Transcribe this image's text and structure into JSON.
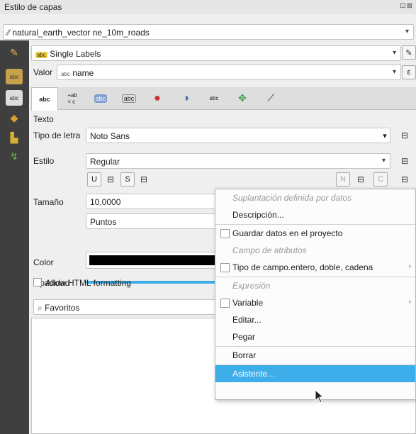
{
  "panel": {
    "title": "Estilo de capas",
    "buttons": "⊡⊠"
  },
  "layer": {
    "name": "natural_earth_vector ne_10m_roads"
  },
  "renderer": {
    "mode": "Single Labels",
    "mode_badge": "abc"
  },
  "value_row": {
    "label": "Valor",
    "field_prefix": "abc",
    "field": "name",
    "expr_symbol": "ε"
  },
  "tabs": [
    {
      "name": "text",
      "glyph": "abc"
    },
    {
      "name": "formatting",
      "glyph": "+ab\n< c"
    },
    {
      "name": "buffer",
      "glyph": "abc"
    },
    {
      "name": "background",
      "glyph": "abc"
    },
    {
      "name": "shadow",
      "glyph": "●"
    },
    {
      "name": "callout",
      "glyph": "◑"
    },
    {
      "name": "placement",
      "glyph": "abc"
    },
    {
      "name": "rendering",
      "glyph": "✥"
    },
    {
      "name": "mask",
      "glyph": "⟋"
    }
  ],
  "section": {
    "title": "Texto"
  },
  "font": {
    "label": "Tipo de letra",
    "value": "Noto Sans"
  },
  "style": {
    "label": "Estilo",
    "value": "Regular"
  },
  "format_buttons": {
    "underline": "U",
    "strike": "S",
    "bold": "N",
    "italic": "C"
  },
  "size": {
    "label": "Tamaño",
    "value": "10,0000",
    "unit": "Puntos"
  },
  "color": {
    "label": "Color",
    "value": "#000000"
  },
  "opacity": {
    "label": "Opacidad"
  },
  "html_formatting": {
    "label": "Allow HTML formatting",
    "checked": false
  },
  "favorites": {
    "label": "Favoritos"
  },
  "menu": {
    "items": [
      {
        "key": "header1",
        "text": "Suplantación definida por datos",
        "disabled": true
      },
      {
        "key": "desc",
        "text": "Descripción..."
      },
      {
        "key": "save",
        "text": "Guardar datos en el proyecto",
        "checkbox": true
      },
      {
        "key": "header2",
        "text": "Campo de atributos",
        "disabled": true
      },
      {
        "key": "fieldtype",
        "text": "Tipo de campo.entero, doble, cadena",
        "checkbox": true,
        "submenu": true
      },
      {
        "key": "header3",
        "text": "Expresión",
        "disabled": true
      },
      {
        "key": "variable",
        "text": "Variable",
        "checkbox": true,
        "submenu": true
      },
      {
        "key": "edit",
        "text": "Editar..."
      },
      {
        "key": "paste",
        "text": "Pegar"
      },
      {
        "key": "clear",
        "text": "Borrar"
      },
      {
        "key": "assistant",
        "text": "Asistente...",
        "highlighted": true
      }
    ]
  }
}
